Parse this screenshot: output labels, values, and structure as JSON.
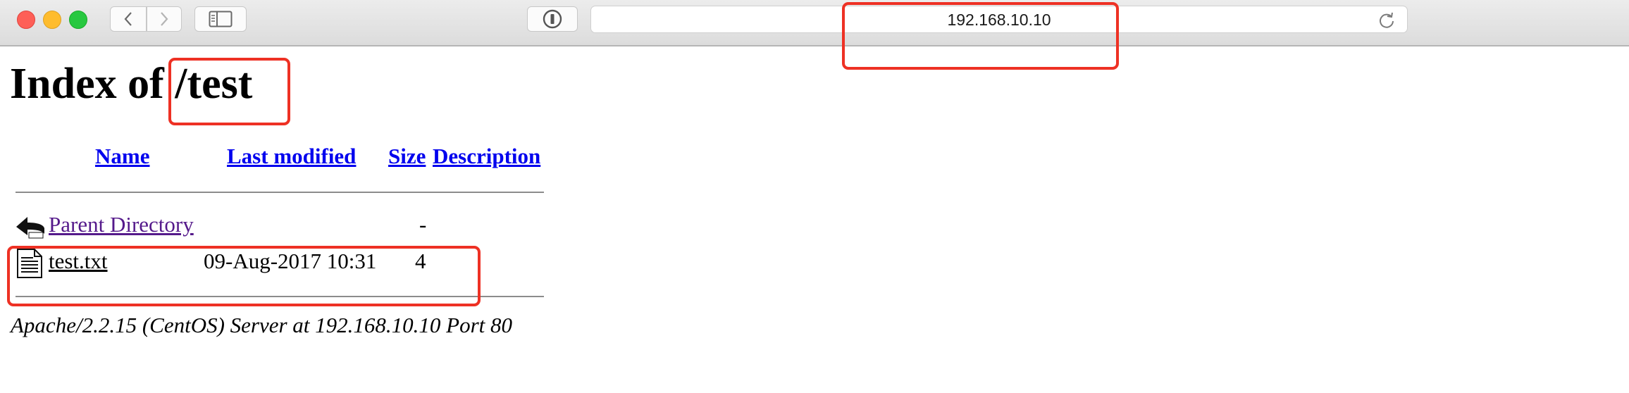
{
  "browser": {
    "url": "192.168.10.10"
  },
  "page": {
    "title": "Index of /test",
    "headers": {
      "name": "Name",
      "last_modified": "Last modified",
      "size": "Size",
      "description": "Description"
    },
    "rows": [
      {
        "icon": "back-arrow-icon",
        "name": "Parent Directory",
        "last_modified": "",
        "size": "-",
        "description": ""
      },
      {
        "icon": "text-file-icon",
        "name": "test.txt",
        "last_modified": "09-Aug-2017 10:31",
        "size": "4",
        "description": ""
      }
    ],
    "footer": "Apache/2.2.15 (CentOS) Server at 192.168.10.10 Port 80"
  },
  "annotation_color": "#ee3124"
}
